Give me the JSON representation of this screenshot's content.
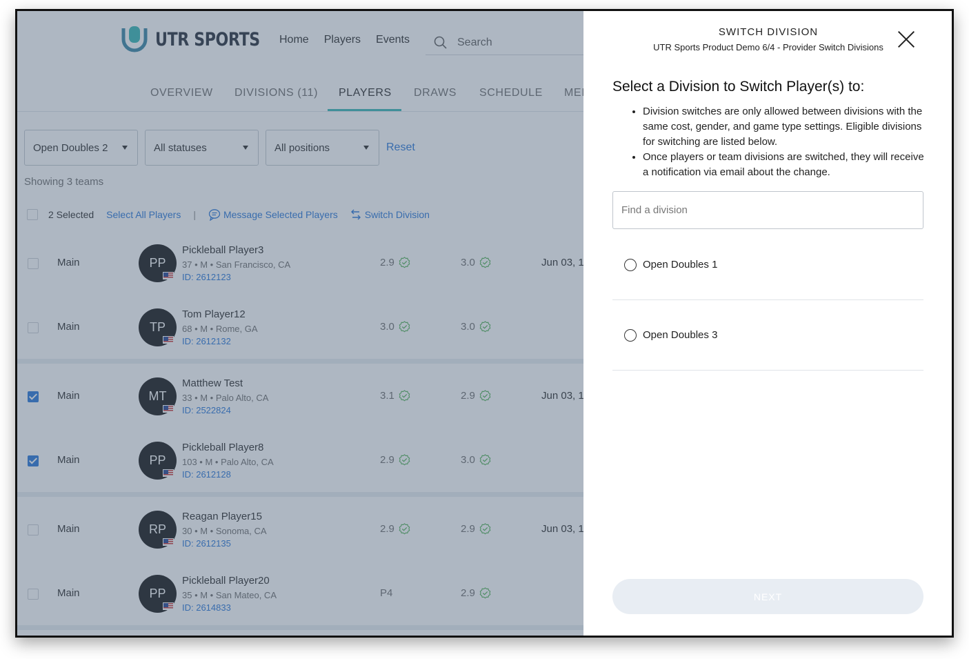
{
  "brand": {
    "logo_text": "UTR SPORTS",
    "accent": "#2bb3b1"
  },
  "nav": {
    "home": "Home",
    "players": "Players",
    "events": "Events",
    "search_placeholder": "Search"
  },
  "tabs": {
    "overview": "OVERVIEW",
    "divisions": "DIVISIONS (11)",
    "players": "PLAYERS",
    "draws": "DRAWS",
    "schedule": "SCHEDULE",
    "media": "MEI"
  },
  "filters": {
    "division": "Open Doubles 2",
    "status": "All statuses",
    "position": "All positions",
    "reset": "Reset"
  },
  "showing": "Showing 3 teams",
  "actions": {
    "selected": "2 Selected",
    "select_all": "Select All Players",
    "divider": "|",
    "message": "Message Selected Players",
    "switch": "Switch Division"
  },
  "groups": [
    {
      "players": [
        {
          "checked": false,
          "position": "Main",
          "initials": "PP",
          "name": "Pickleball Player3",
          "meta": "37 • M • San Francisco, CA",
          "id": "ID: 2612123",
          "rating1": "2.9",
          "rating1_verified": true,
          "rating2": "3.0",
          "rating2_verified": true,
          "date": "Jun 03, 1"
        },
        {
          "checked": false,
          "position": "Main",
          "initials": "TP",
          "name": "Tom Player12",
          "meta": "68 • M • Rome, GA",
          "id": "ID: 2612132",
          "rating1": "3.0",
          "rating1_verified": true,
          "rating2": "3.0",
          "rating2_verified": true,
          "date": ""
        }
      ]
    },
    {
      "players": [
        {
          "checked": true,
          "position": "Main",
          "initials": "MT",
          "name": "Matthew Test",
          "meta": "33 • M • Palo Alto, CA",
          "id": "ID: 2522824",
          "rating1": "3.1",
          "rating1_verified": true,
          "rating2": "2.9",
          "rating2_verified": true,
          "date": "Jun 03, 1"
        },
        {
          "checked": true,
          "position": "Main",
          "initials": "PP",
          "name": "Pickleball Player8",
          "meta": "103 • M • Palo Alto, CA",
          "id": "ID: 2612128",
          "rating1": "2.9",
          "rating1_verified": true,
          "rating2": "3.0",
          "rating2_verified": true,
          "date": ""
        }
      ]
    },
    {
      "players": [
        {
          "checked": false,
          "position": "Main",
          "initials": "RP",
          "name": "Reagan Player15",
          "meta": "30 • M • Sonoma, CA",
          "id": "ID: 2612135",
          "rating1": "2.9",
          "rating1_verified": true,
          "rating2": "2.9",
          "rating2_verified": true,
          "date": "Jun 03, 1"
        },
        {
          "checked": false,
          "position": "Main",
          "initials": "PP",
          "name": "Pickleball Player20",
          "meta": "35 • M • San Mateo, CA",
          "id": "ID: 2614833",
          "rating1": "P4",
          "rating1_verified": false,
          "rating2": "2.9",
          "rating2_verified": true,
          "date": ""
        }
      ]
    }
  ],
  "modal": {
    "title": "SWITCH DIVISION",
    "subtitle": "UTR Sports Product Demo 6/4 - Provider Switch Divisions",
    "heading": "Select a Division to Switch Player(s) to:",
    "notes": [
      "Division switches are only allowed between divisions with the same cost, gender, and game type settings. Eligible divisions for switching are listed below.",
      "Once players or team divisions are switched, they will receive a notification via email about the change."
    ],
    "find_placeholder": "Find a division",
    "options": [
      "Open Doubles 1",
      "Open Doubles 3"
    ],
    "next_label": "NEXT"
  }
}
